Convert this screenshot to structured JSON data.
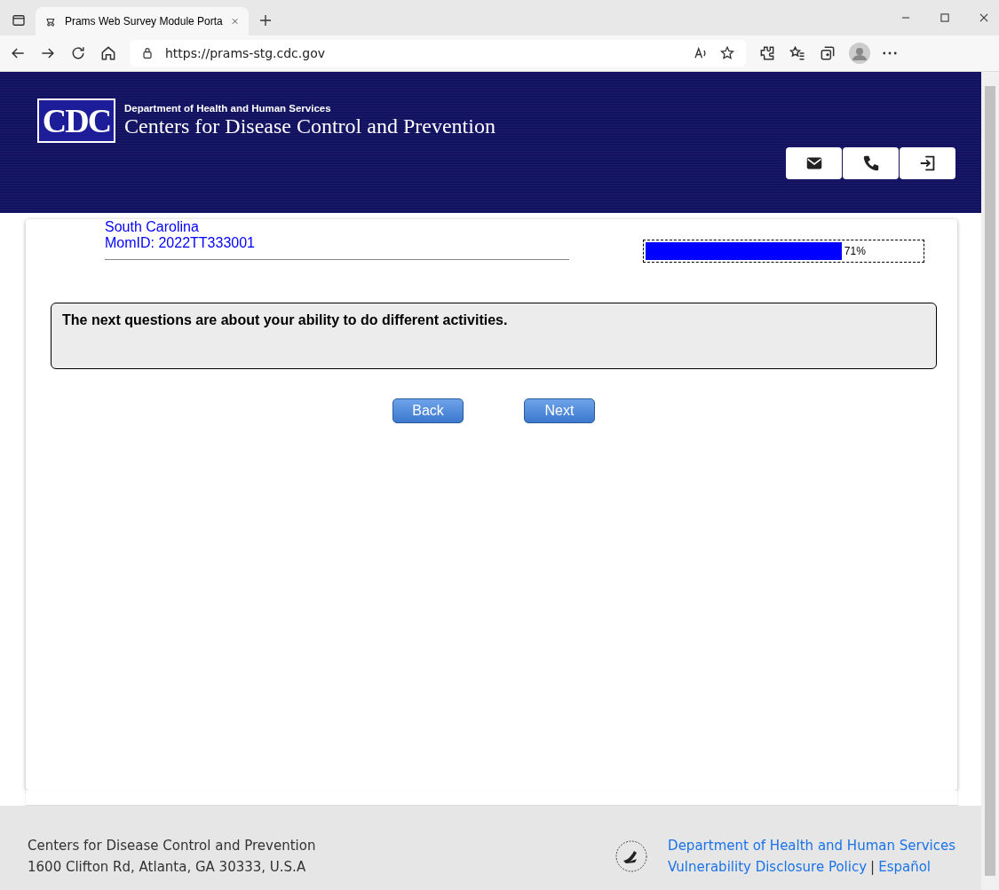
{
  "browser": {
    "tab_title": "Prams Web Survey Module Porta",
    "url": "https://prams-stg.cdc.gov"
  },
  "header": {
    "logo": "CDC",
    "department": "Department of Health and Human Services",
    "agency": "Centers for Disease Control and Prevention"
  },
  "respondent": {
    "state": "South Carolina",
    "mom_id": "MomID: 2022TT333001"
  },
  "progress": {
    "level": 0.71,
    "reading": "71%"
  },
  "question": "The next questions are about your ability to do different activities.",
  "buttons": [
    {
      "label": "Back"
    },
    {
      "label": "Next"
    }
  ],
  "footer": {
    "org": "Centers for Disease Control and Prevention",
    "address": "1600 Clifton Rd, Atlanta, GA 30333, U.S.A",
    "links": [
      "Department of Health and Human Services",
      "Vulnerability Disclosure Policy",
      "Español"
    ],
    "separator": "|"
  }
}
